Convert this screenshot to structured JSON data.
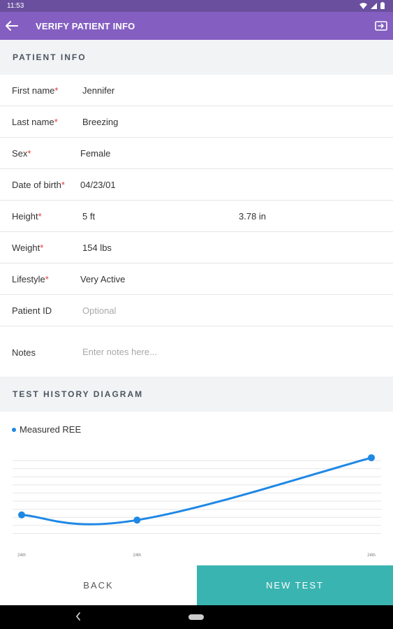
{
  "status_bar": {
    "time": "11:53"
  },
  "app_bar": {
    "title": "VERIFY PATIENT INFO"
  },
  "patient_info": {
    "header": "PATIENT INFO",
    "required_mark": "*",
    "first_name": {
      "label": "First name",
      "value": "Jennifer"
    },
    "last_name": {
      "label": "Last name",
      "value": "Breezing"
    },
    "sex": {
      "label": "Sex",
      "value": "Female"
    },
    "dob": {
      "label": "Date of birth",
      "value": "04/23/01"
    },
    "height": {
      "label": "Height",
      "feet": "5 ft",
      "inches": "3.78 in"
    },
    "weight": {
      "label": "Weight",
      "value": "154 lbs"
    },
    "lifestyle": {
      "label": "Lifestyle",
      "value": "Very Active"
    },
    "patient_id": {
      "label": "Patient ID",
      "placeholder": "Optional"
    },
    "notes": {
      "label": "Notes",
      "placeholder": "Enter notes here..."
    }
  },
  "test_history": {
    "header": "TEST HISTORY DIAGRAM"
  },
  "chart_data": {
    "type": "line",
    "series": [
      {
        "name": "Measured REE",
        "values": [
          1.25,
          1.1,
          2.9
        ]
      }
    ],
    "x_labels": [
      "24th",
      "24th",
      "24th"
    ],
    "x_positions": [
      0,
      0.33,
      1
    ],
    "ylim": [
      0.7,
      3.0
    ],
    "grid": true,
    "legend": "top-left",
    "color": "#1e88e5",
    "smooth": true
  },
  "buttons": {
    "back": "BACK",
    "new_test": "NEW TEST"
  },
  "colors": {
    "status_bar": "#6a4f9e",
    "app_bar": "#845fc1",
    "accent_teal": "#3ab4b0",
    "series_blue": "#1e88e5",
    "required_red": "#e53935"
  }
}
